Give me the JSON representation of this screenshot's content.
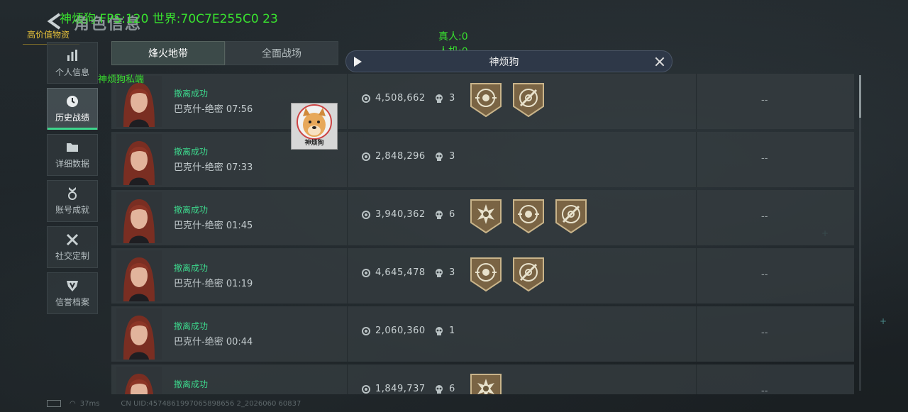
{
  "header": {
    "title": "角色信息",
    "overlay_top": "神烦狗  FPS:120 世界:70C7E255C0 23",
    "overlay_high_value": "高价值物资",
    "overlay_real": "真人:0",
    "overlay_bot": "人机:0",
    "overlay_private": "神烦狗私端"
  },
  "sidebar": {
    "items": [
      {
        "label": "个人信息",
        "icon": "bar-chart-icon"
      },
      {
        "label": "历史战绩",
        "icon": "clock-icon"
      },
      {
        "label": "详细数据",
        "icon": "folder-icon"
      },
      {
        "label": "账号成就",
        "icon": "medal-icon"
      },
      {
        "label": "社交定制",
        "icon": "tools-icon"
      },
      {
        "label": "信誉档案",
        "icon": "shield-icon"
      }
    ],
    "active_index": 1
  },
  "tabs": [
    {
      "label": "烽火地带",
      "active": true
    },
    {
      "label": "全面战场",
      "active": false
    }
  ],
  "video": {
    "title": "神烦狗"
  },
  "sticker": {
    "label": "神烦狗"
  },
  "rows": [
    {
      "status": "撤离成功",
      "map": "巴克什-绝密 07:56",
      "value": "4,508,662",
      "kills": "3",
      "badges": [
        "shield-emblem-badge",
        "crosshair-badge"
      ],
      "extra": "--"
    },
    {
      "status": "撤离成功",
      "map": "巴克什-绝密 07:33",
      "value": "2,848,296",
      "kills": "3",
      "badges": [],
      "extra": "--"
    },
    {
      "status": "撤离成功",
      "map": "巴克什-绝密 01:45",
      "value": "3,940,362",
      "kills": "6",
      "badges": [
        "burst-badge",
        "shield-emblem-badge",
        "crosshair-badge"
      ],
      "extra": "--"
    },
    {
      "status": "撤离成功",
      "map": "巴克什-绝密 01:19",
      "value": "4,645,478",
      "kills": "3",
      "badges": [
        "shield-emblem-badge",
        "crosshair-badge"
      ],
      "extra": "--"
    },
    {
      "status": "撤离成功",
      "map": "巴克什-绝密 00:44",
      "value": "2,060,360",
      "kills": "1",
      "badges": [],
      "extra": "--"
    },
    {
      "status": "撤离成功",
      "map": "",
      "value": "1,849,737",
      "kills": "6",
      "badges": [
        "burst-badge"
      ],
      "extra": "--"
    }
  ],
  "status_bar": {
    "ping": "37ms",
    "uid": "CN UID:4574861997065898656 2_2026060 60837"
  },
  "colors": {
    "accent_green": "#3dd68c",
    "overlay_green": "#39e22f",
    "overlay_yellow": "#e8c33a"
  }
}
